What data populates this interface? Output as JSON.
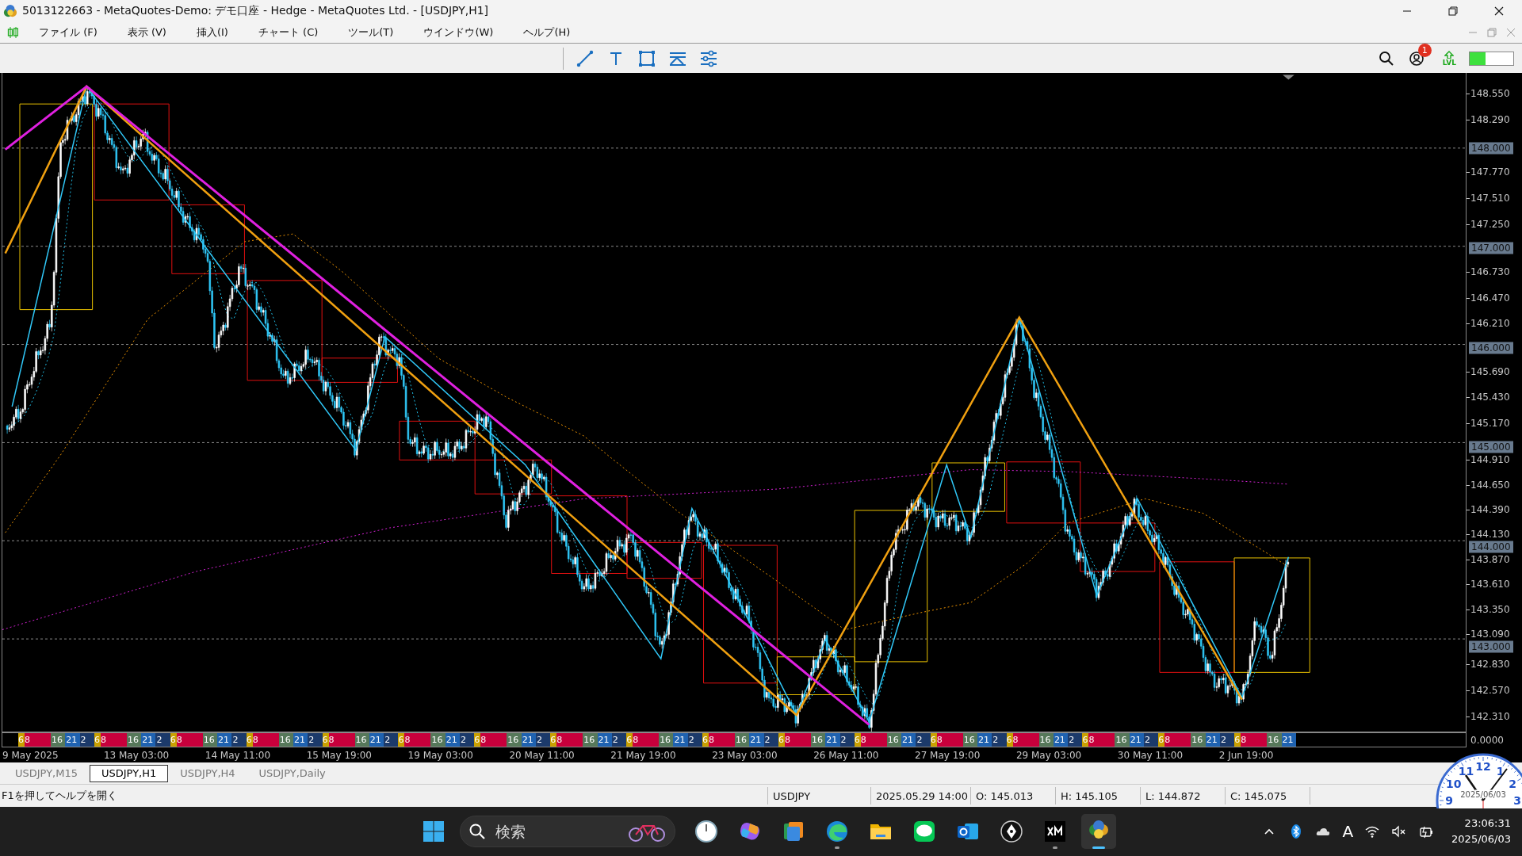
{
  "window": {
    "title": "5013122663 - MetaQuotes-Demo: デモ口座 - Hedge - MetaQuotes Ltd. - [USDJPY,H1]"
  },
  "menu": [
    "ファイル (F)",
    "表示 (V)",
    "挿入(I)",
    "チャート (C)",
    "ツール(T)",
    "ウインドウ(W)",
    "ヘルプ(H)"
  ],
  "toolbar": {
    "notification_badge": "1",
    "level_badge": "LVL",
    "meter": {
      "level": 0.37
    }
  },
  "chart": {
    "price_axis": [
      {
        "ticks": [
          "148.550",
          "148.290"
        ]
      },
      {
        "level": "148.000",
        "ticks": [
          "147.770",
          "147.510",
          "147.250"
        ]
      },
      {
        "level": "147.000",
        "ticks": [
          "146.730",
          "146.470",
          "146.210"
        ]
      },
      {
        "level": "146.000",
        "ticks": [
          "145.690",
          "145.430",
          "145.170"
        ]
      },
      {
        "level": "145.000",
        "ticks": [
          "144.910",
          "144.650",
          "144.390",
          "144.130"
        ]
      },
      {
        "level": "144.000",
        "ticks": [
          "143.870",
          "143.610",
          "143.350",
          "143.090"
        ]
      },
      {
        "level": "143.000",
        "ticks": [
          "142.830",
          "142.570",
          "142.310"
        ]
      }
    ],
    "indicator_axis": "0.0000",
    "session_strip": [
      {
        "text": "6",
        "kind": "narrow",
        "color": "#c9a000"
      },
      {
        "text": "8",
        "kind": "wide",
        "color": "#c8003c"
      },
      {
        "text": "16",
        "kind": "mid",
        "color": "#56785a"
      },
      {
        "text": "21",
        "kind": "mid",
        "color": "#1f62b0"
      },
      {
        "text": "2",
        "kind": "mid",
        "color": "#1c3a6a"
      },
      {
        "text": "6",
        "kind": "narrow",
        "color": "#c9a000"
      },
      {
        "text": "8",
        "kind": "wide",
        "color": "#c8003c"
      },
      {
        "text": "16",
        "kind": "mid",
        "color": "#56785a"
      },
      {
        "text": "21",
        "kind": "mid",
        "color": "#1f62b0"
      },
      {
        "text": "2",
        "kind": "mid",
        "color": "#1c3a6a"
      },
      {
        "text": "6",
        "kind": "narrow",
        "color": "#c9a000"
      },
      {
        "text": "8",
        "kind": "wide",
        "color": "#c8003c"
      },
      {
        "text": "16",
        "kind": "mid",
        "color": "#56785a"
      },
      {
        "text": "21",
        "kind": "mid",
        "color": "#1f62b0"
      },
      {
        "text": "2",
        "kind": "mid",
        "color": "#1c3a6a"
      },
      {
        "text": "6",
        "kind": "narrow",
        "color": "#c9a000"
      },
      {
        "text": "8",
        "kind": "wide",
        "color": "#c8003c"
      },
      {
        "text": "16",
        "kind": "mid",
        "color": "#56785a"
      },
      {
        "text": "21",
        "kind": "mid",
        "color": "#1f62b0"
      },
      {
        "text": "2",
        "kind": "mid",
        "color": "#1c3a6a"
      },
      {
        "text": "6",
        "kind": "narrow",
        "color": "#c9a000"
      },
      {
        "text": "8",
        "kind": "wide",
        "color": "#c8003c"
      },
      {
        "text": "16",
        "kind": "mid",
        "color": "#56785a"
      },
      {
        "text": "21",
        "kind": "mid",
        "color": "#1f62b0"
      },
      {
        "text": "2",
        "kind": "mid",
        "color": "#1c3a6a"
      },
      {
        "text": "6",
        "kind": "narrow",
        "color": "#c9a000"
      },
      {
        "text": "8",
        "kind": "wide",
        "color": "#c8003c"
      },
      {
        "text": "16",
        "kind": "mid",
        "color": "#56785a"
      },
      {
        "text": "21",
        "kind": "mid",
        "color": "#1f62b0"
      },
      {
        "text": "2",
        "kind": "mid",
        "color": "#1c3a6a"
      },
      {
        "text": "6",
        "kind": "narrow",
        "color": "#c9a000"
      },
      {
        "text": "8",
        "kind": "wide",
        "color": "#c8003c"
      },
      {
        "text": "16",
        "kind": "mid",
        "color": "#56785a"
      },
      {
        "text": "21",
        "kind": "mid",
        "color": "#1f62b0"
      },
      {
        "text": "2",
        "kind": "mid",
        "color": "#1c3a6a"
      },
      {
        "text": "6",
        "kind": "narrow",
        "color": "#c9a000"
      },
      {
        "text": "8",
        "kind": "wide",
        "color": "#c8003c"
      },
      {
        "text": "16",
        "kind": "mid",
        "color": "#56785a"
      },
      {
        "text": "21",
        "kind": "mid",
        "color": "#1f62b0"
      },
      {
        "text": "2",
        "kind": "mid",
        "color": "#1c3a6a"
      },
      {
        "text": "6",
        "kind": "narrow",
        "color": "#c9a000"
      },
      {
        "text": "8",
        "kind": "wide",
        "color": "#c8003c"
      },
      {
        "text": "16",
        "kind": "mid",
        "color": "#56785a"
      },
      {
        "text": "21",
        "kind": "mid",
        "color": "#1f62b0"
      },
      {
        "text": "2",
        "kind": "mid",
        "color": "#1c3a6a"
      },
      {
        "text": "6",
        "kind": "narrow",
        "color": "#c9a000"
      },
      {
        "text": "8",
        "kind": "wide",
        "color": "#c8003c"
      },
      {
        "text": "16",
        "kind": "mid",
        "color": "#56785a"
      },
      {
        "text": "21",
        "kind": "mid",
        "color": "#1f62b0"
      },
      {
        "text": "2",
        "kind": "mid",
        "color": "#1c3a6a"
      },
      {
        "text": "6",
        "kind": "narrow",
        "color": "#c9a000"
      },
      {
        "text": "8",
        "kind": "wide",
        "color": "#c8003c"
      },
      {
        "text": "16",
        "kind": "mid",
        "color": "#56785a"
      },
      {
        "text": "21",
        "kind": "mid",
        "color": "#1f62b0"
      },
      {
        "text": "2",
        "kind": "mid",
        "color": "#1c3a6a"
      },
      {
        "text": "6",
        "kind": "narrow",
        "color": "#c9a000"
      },
      {
        "text": "8",
        "kind": "wide",
        "color": "#c8003c"
      },
      {
        "text": "16",
        "kind": "mid",
        "color": "#56785a"
      },
      {
        "text": "21",
        "kind": "mid",
        "color": "#1f62b0"
      },
      {
        "text": "2",
        "kind": "mid",
        "color": "#1c3a6a"
      },
      {
        "text": "6",
        "kind": "narrow",
        "color": "#c9a000"
      },
      {
        "text": "8",
        "kind": "wide",
        "color": "#c8003c"
      },
      {
        "text": "16",
        "kind": "mid",
        "color": "#56785a"
      },
      {
        "text": "21",
        "kind": "mid",
        "color": "#1f62b0"
      },
      {
        "text": "2",
        "kind": "mid",
        "color": "#1c3a6a"
      },
      {
        "text": "6",
        "kind": "narrow",
        "color": "#c9a000"
      },
      {
        "text": "8",
        "kind": "wide",
        "color": "#c8003c"
      },
      {
        "text": "16",
        "kind": "mid",
        "color": "#56785a"
      },
      {
        "text": "21",
        "kind": "mid",
        "color": "#1f62b0"
      },
      {
        "text": "2",
        "kind": "mid",
        "color": "#1c3a6a"
      },
      {
        "text": "6",
        "kind": "narrow",
        "color": "#c9a000"
      },
      {
        "text": "8",
        "kind": "wide",
        "color": "#c8003c"
      },
      {
        "text": "16",
        "kind": "mid",
        "color": "#56785a"
      },
      {
        "text": "21",
        "kind": "mid",
        "color": "#1f62b0"
      },
      {
        "text": "2",
        "kind": "mid",
        "color": "#1c3a6a"
      },
      {
        "text": "6",
        "kind": "narrow",
        "color": "#c9a000"
      },
      {
        "text": "8",
        "kind": "wide",
        "color": "#c8003c"
      },
      {
        "text": "16",
        "kind": "mid",
        "color": "#56785a"
      },
      {
        "text": "21",
        "kind": "mid",
        "color": "#1f62b0"
      },
      {
        "text": "2",
        "kind": "mid",
        "color": "#1c3a6a"
      },
      {
        "text": "6",
        "kind": "narrow",
        "color": "#c9a000"
      },
      {
        "text": "8",
        "kind": "wide",
        "color": "#c8003c"
      },
      {
        "text": "16",
        "kind": "mid",
        "color": "#56785a"
      },
      {
        "text": "21",
        "kind": "mid",
        "color": "#1f62b0"
      }
    ],
    "time_axis": [
      "9 May 2025",
      "13 May 03:00",
      "14 May 11:00",
      "15 May 19:00",
      "19 May 03:00",
      "20 May 11:00",
      "21 May 19:00",
      "23 May 03:00",
      "26 May 11:00",
      "27 May 19:00",
      "29 May 03:00",
      "30 May 11:00",
      "2 Jun 19:00"
    ]
  },
  "tabs": [
    {
      "label": "USDJPY,M15",
      "selected": false
    },
    {
      "label": "USDJPY,H1",
      "selected": true
    },
    {
      "label": "USDJPY,H4",
      "selected": false
    },
    {
      "label": "USDJPY,Daily",
      "selected": false
    }
  ],
  "status_bar": {
    "help": "F1を押してヘルプを開く",
    "symbol": "USDJPY",
    "time": "2025.05.29 14:00",
    "open": "O: 145.013",
    "high": "H: 145.105",
    "low": "L: 144.872",
    "close": "C: 145.075"
  },
  "clock_widget": {
    "numerals": [
      "12",
      "1",
      "2",
      "3",
      "9",
      "10",
      "11"
    ],
    "date": "2025/06/03"
  },
  "taskbar": {
    "search": {
      "placeholder": "検索"
    },
    "tray": {
      "ime": "A",
      "time": "23:06:31",
      "date": "2025/06/03"
    }
  }
}
